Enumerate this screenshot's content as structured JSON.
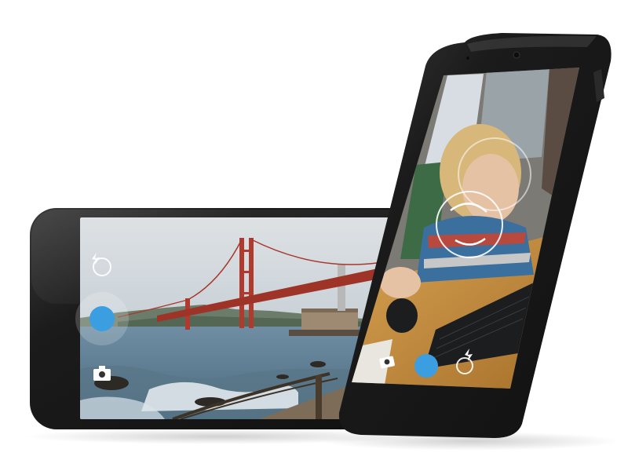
{
  "scene": {
    "background": "#ffffff",
    "device_color": "#1b1b1b",
    "screen_dark": "#0d0d0d"
  },
  "landscape_phone": {
    "orientation": "landscape",
    "camera_ui": {
      "shutter_color": "#3b9ee0",
      "shutter_ring": "rgba(255,255,255,0.18)",
      "controls": [
        {
          "name": "flash-auto-icon",
          "role": "flash toggle"
        },
        {
          "name": "shutter-button",
          "role": "capture"
        },
        {
          "name": "camera-switch-icon",
          "role": "switch mode"
        }
      ]
    },
    "scene_colors": {
      "sky_top": "#dde1e4",
      "sky_bottom": "#b6c2cb",
      "bridge": "#b03a2e",
      "hills": "#6b7d6a",
      "water": "#5f7e93",
      "foam": "#e7eef2"
    }
  },
  "portrait_phone": {
    "orientation": "portrait",
    "camera_ui": {
      "shutter_color": "#3b9ee0",
      "focus_ring_color": "#ffffff",
      "controls": [
        {
          "name": "camera-switch-icon",
          "role": "switch mode"
        },
        {
          "name": "shutter-button",
          "role": "capture"
        },
        {
          "name": "flash-auto-icon",
          "role": "flash toggle"
        }
      ]
    },
    "scene_colors": {
      "wall": "#7c7a74",
      "desk": "#c9923f",
      "hair": "#d7b77a",
      "sweater": "#3a6f9e",
      "keyboard": "#1c1d1f"
    }
  }
}
